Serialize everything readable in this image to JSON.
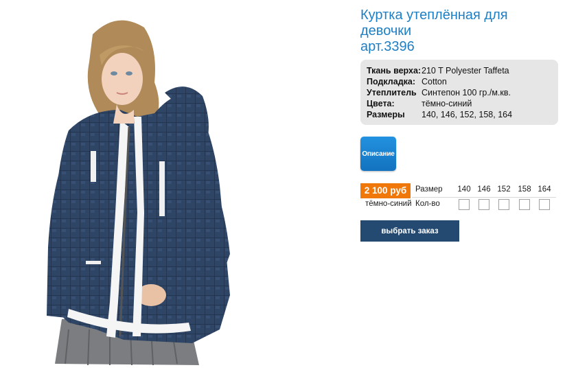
{
  "product": {
    "title_line1": "Куртка утеплённая для",
    "title_line2": "девочки",
    "title_line3": "арт.3396",
    "image_alt": "jacket-photo"
  },
  "specs": [
    {
      "label": "Ткань верха:",
      "value": "210 T Polyester Taffeta"
    },
    {
      "label": "Подкладка:",
      "value": "Cotton"
    },
    {
      "label": "Утеплитель",
      "value": "Синтепон 100 гр./м.кв."
    },
    {
      "label": "Цвета:",
      "value": "тёмно-синий"
    },
    {
      "label": "Размеры",
      "value": "140, 146, 152, 158, 164"
    }
  ],
  "description_button": "Описание",
  "order": {
    "price": "2 100 руб",
    "color": "тёмно-синий",
    "size_label": "Размер",
    "qty_label": "Кол-во",
    "sizes": [
      "140",
      "146",
      "152",
      "158",
      "164"
    ],
    "button": "выбрать заказ"
  },
  "colors": {
    "title": "#1d7fc4",
    "price_badge": "#f0780a",
    "order_button": "#244a72",
    "desc_button": "#1a82d2",
    "jacket": "#2e4566"
  }
}
